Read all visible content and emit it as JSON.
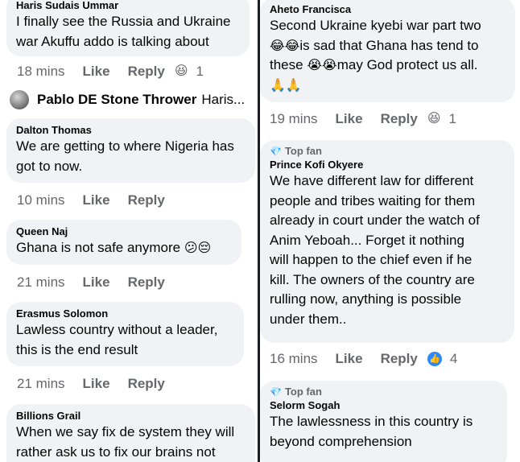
{
  "left": {
    "c1": {
      "author": "Haris Sudais Ummar",
      "lines": [
        "I finally see the Russia and Ukraine",
        "war Akuffu addo is talking about"
      ],
      "time": "18 mins",
      "like": "Like",
      "reply": "Reply",
      "reaction_icon": "laughing-face-icon",
      "reaction_count": "1"
    },
    "reply_preview": {
      "author": "Pablo DE Stone Thrower",
      "text": "Haris..."
    },
    "c2": {
      "author": "Dalton Thomas",
      "lines": [
        "We are getting to where Nigeria has",
        "got to now."
      ],
      "time": "10 mins",
      "like": "Like",
      "reply": "Reply"
    },
    "c3": {
      "author": "Queen Naj",
      "text": "Ghana is not safe anymore",
      "time": "21 mins",
      "like": "Like",
      "reply": "Reply"
    },
    "c4": {
      "author": "Erasmus Solomon",
      "lines": [
        "Lawless country without a leader,",
        "this is the end result"
      ],
      "time": "21 mins",
      "like": "Like",
      "reply": "Reply"
    },
    "c5": {
      "author": "Billions Grail",
      "lines": [
        "When we say fix de system they will",
        "rather ask us to fix our brains not"
      ]
    }
  },
  "right": {
    "c1": {
      "author": "Aheto Francisca",
      "line1": "Second Ukraine kyebi war part two",
      "line2": "is sad that Ghana has tend to",
      "line3a": "these",
      "line3b": "may God protect us all.",
      "time": "19 mins",
      "like": "Like",
      "reply": "Reply",
      "reaction_icon": "laughing-face-icon",
      "reaction_count": "1"
    },
    "c2": {
      "badge": "Top fan",
      "author": "Prince Kofi Okyere",
      "lines": [
        "We have different law for different",
        "people and tribes waiting for them",
        "already in court under the watch of",
        "Anim Yeboah... Forget it nothing",
        "will happen to the chief even if he",
        "kill. The owners of the country are",
        "rulling now, anything is possible",
        "under them.."
      ],
      "time": "16 mins",
      "like": "Like",
      "reply": "Reply",
      "reaction_icon": "thumbs-up-icon",
      "reaction_count": "4"
    },
    "c3": {
      "badge": "Top fan",
      "author": "Selorm Sogah",
      "lines": [
        "The lawlessness in this country is",
        "beyond comprehension"
      ]
    }
  },
  "colors": {
    "bubble": "#f0f2f5",
    "meta": "#65676b",
    "text": "#050505",
    "like_blue": "#2e89ff",
    "divider": "#1c1e21"
  }
}
